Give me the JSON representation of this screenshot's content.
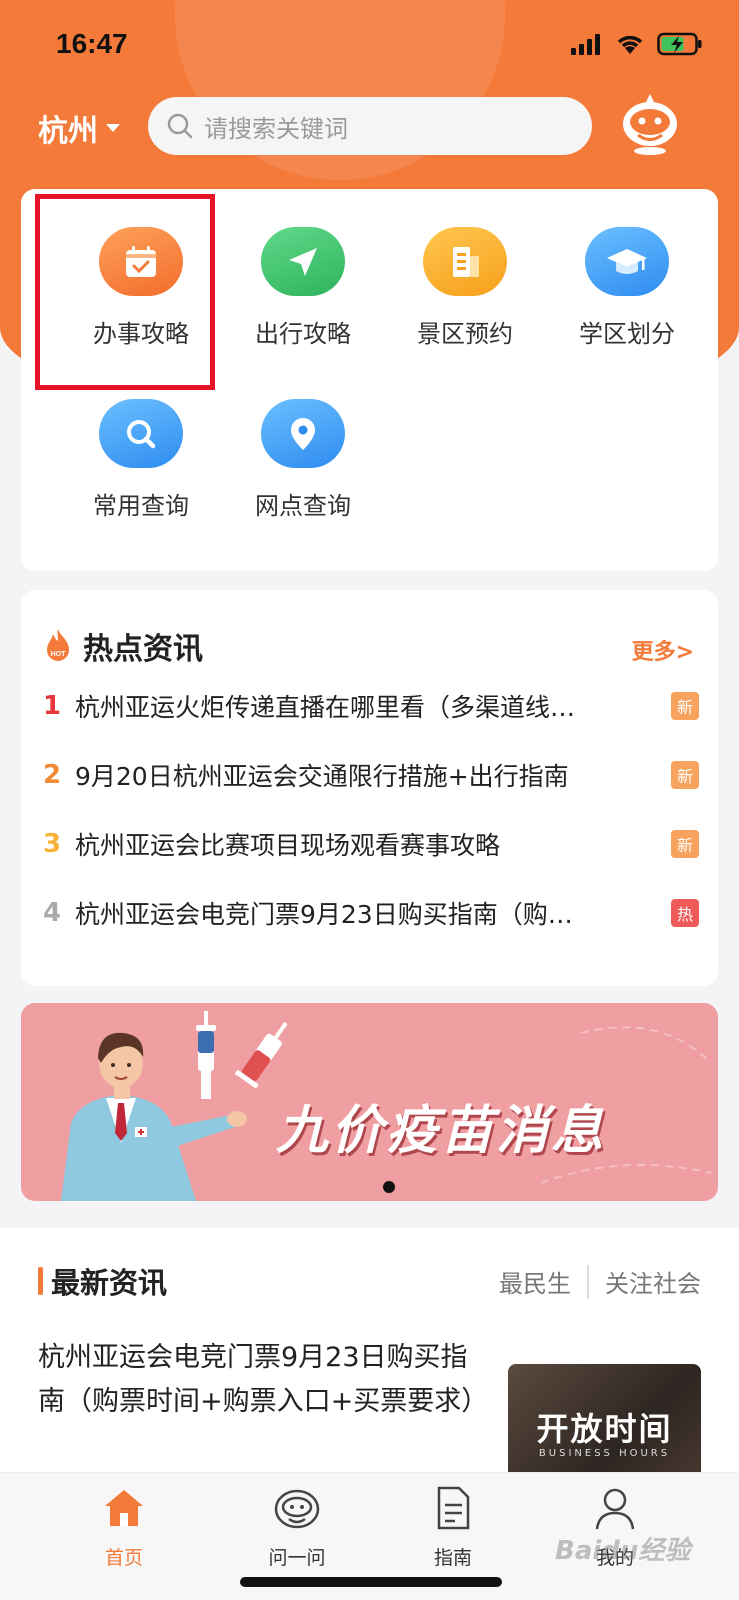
{
  "status_bar": {
    "time": "16:47"
  },
  "header": {
    "city": "杭州",
    "search_placeholder": "请搜索关键词"
  },
  "shortcuts": [
    {
      "label": "办事攻略",
      "icon": "calendar-check-icon",
      "color": "#f47a3a"
    },
    {
      "label": "出行攻略",
      "icon": "navigation-arrow-icon",
      "color": "#3ec16a"
    },
    {
      "label": "景区预约",
      "icon": "building-icon",
      "color": "#f7a823"
    },
    {
      "label": "学区划分",
      "icon": "graduation-cap-icon",
      "color": "#3d9df5"
    },
    {
      "label": "常用查询",
      "icon": "magnifier-icon",
      "color": "#3d9df5"
    },
    {
      "label": "网点查询",
      "icon": "map-pin-icon",
      "color": "#3d9df5"
    }
  ],
  "hot_news": {
    "title": "热点资讯",
    "more": "更多>",
    "items": [
      {
        "rank": "1",
        "rank_color": "#e8363d",
        "text": "杭州亚运火炬传递直播在哪里看（多渠道线…",
        "badge": "新",
        "badge_color": "#f7a35e"
      },
      {
        "rank": "2",
        "rank_color": "#f08a35",
        "text": "9月20日杭州亚运会交通限行措施+出行指南",
        "badge": "新",
        "badge_color": "#f7a35e"
      },
      {
        "rank": "3",
        "rank_color": "#f7b23b",
        "text": "杭州亚运会比赛项目现场观看赛事攻略",
        "badge": "新",
        "badge_color": "#f7a35e"
      },
      {
        "rank": "4",
        "rank_color": "#aaaaaa",
        "text": "杭州亚运会电竞门票9月23日购买指南（购…",
        "badge": "热",
        "badge_color": "#ef5a5a"
      }
    ]
  },
  "banner": {
    "text": "九价疫苗消息"
  },
  "latest": {
    "title": "最新资讯",
    "tabs": [
      "最民生",
      "关注社会"
    ],
    "article_title": "杭州亚运会电竞门票9月23日购买指南（购票时间+购票入口+买票要求）",
    "thumb_title": "开放时间",
    "thumb_subtitle": "BUSINESS HOURS"
  },
  "tabbar": {
    "items": [
      {
        "label": "首页",
        "icon": "home-icon",
        "active": true
      },
      {
        "label": "问一问",
        "icon": "robot-icon",
        "active": false
      },
      {
        "label": "指南",
        "icon": "document-icon",
        "active": false
      },
      {
        "label": "我的",
        "icon": "user-icon",
        "active": false
      }
    ]
  },
  "watermark": "Baidu经验"
}
